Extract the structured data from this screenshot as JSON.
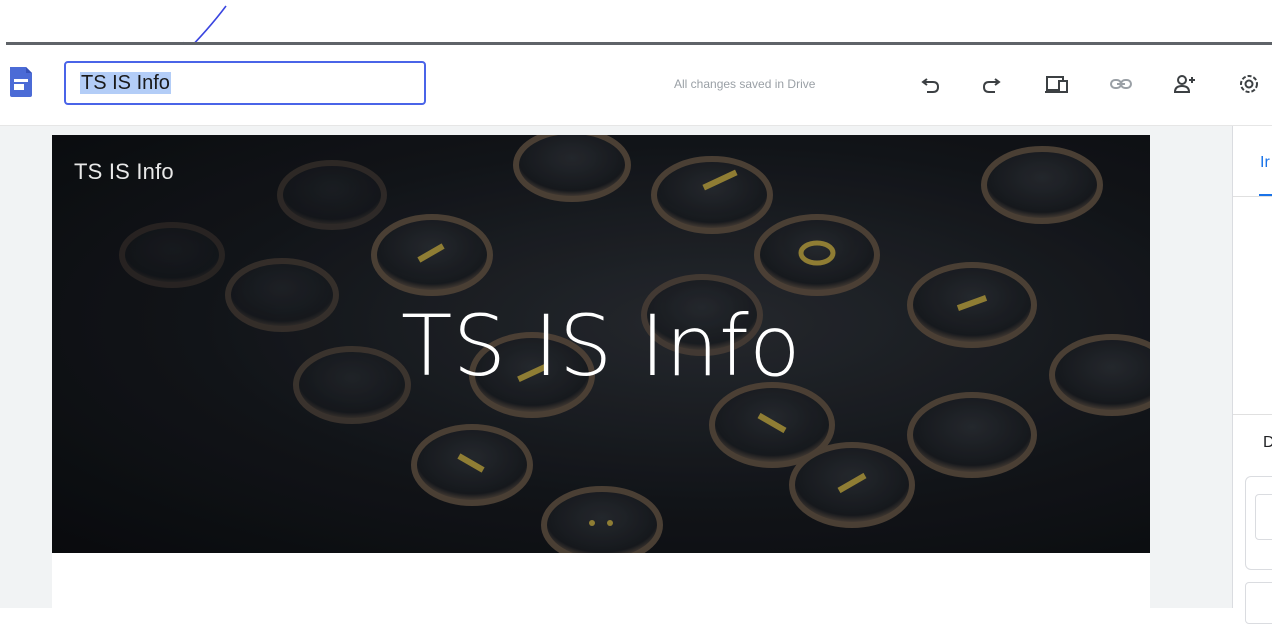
{
  "editor": {
    "site_title_input_value": "TS IS Info",
    "save_status": "All changes saved in Drive",
    "toolbar_icons": [
      "undo-icon",
      "redo-icon",
      "preview-icon",
      "link-icon",
      "share-icon",
      "settings-icon"
    ]
  },
  "page": {
    "site_name": "TS  IS Info",
    "banner_title": "TS IS Info"
  },
  "side_panel": {
    "tab_label": "Ir",
    "section_letter": "D"
  },
  "colors": {
    "accent": "#4a64e8",
    "selection": "#b3cdf7",
    "sites_brand": "#4b6bd6",
    "panel_blue": "#1a73e8"
  }
}
